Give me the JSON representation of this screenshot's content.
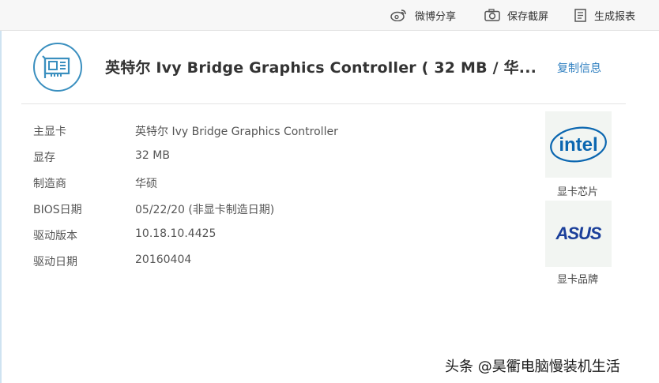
{
  "toolbar": {
    "share_label": "微博分享",
    "screenshot_label": "保存截屏",
    "report_label": "生成报表"
  },
  "header": {
    "title": "英特尔 Ivy Bridge Graphics Controller ( 32 MB / 华...",
    "copy_label": "复制信息",
    "icon": "graphics-card-icon"
  },
  "info": [
    {
      "label": "主显卡",
      "value": "英特尔 Ivy Bridge Graphics Controller"
    },
    {
      "label": "显存",
      "value": "32 MB"
    },
    {
      "label": "制造商",
      "value": "华硕"
    },
    {
      "label": "BIOS日期",
      "value": "05/22/20 (非显卡制造日期)"
    },
    {
      "label": "驱动版本",
      "value": "10.18.10.4425"
    },
    {
      "label": "驱动日期",
      "value": "20160404"
    }
  ],
  "logos": {
    "chip": {
      "name": "intel",
      "caption": "显卡芯片"
    },
    "brand": {
      "name": "ASUS",
      "caption": "显卡品牌"
    }
  },
  "watermark": "头条 @昊衢电脑慢装机生活",
  "colors": {
    "accent": "#2f7fc0",
    "icon_ring": "#3a8fbf",
    "intel_blue": "#0a66b0",
    "asus_blue": "#1b3f9a"
  }
}
